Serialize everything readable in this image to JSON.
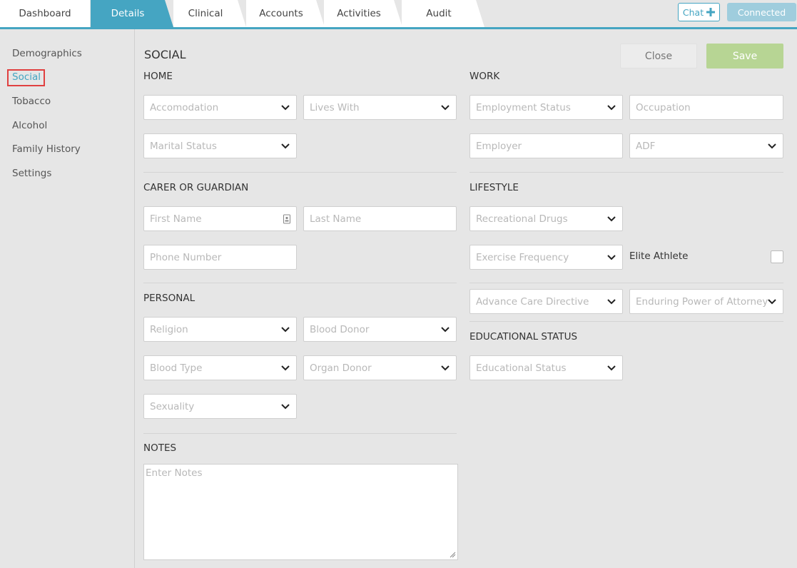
{
  "tabs": [
    "Dashboard",
    "Details",
    "Clinical",
    "Accounts",
    "Activities",
    "Audit"
  ],
  "header": {
    "chat_label": "Chat",
    "connected_label": "Connected"
  },
  "sidebar": {
    "items": [
      "Demographics",
      "Social",
      "Tobacco",
      "Alcohol",
      "Family History",
      "Settings"
    ],
    "active": "Social"
  },
  "page": {
    "title": "SOCIAL",
    "close_label": "Close",
    "save_label": "Save"
  },
  "sections": {
    "home": "HOME",
    "work": "WORK",
    "carer": "CARER OR GUARDIAN",
    "lifestyle": "LIFESTYLE",
    "personal": "PERSONAL",
    "educational": "EDUCATIONAL STATUS",
    "notes": "NOTES"
  },
  "fields": {
    "accomodation": "Accomodation",
    "lives_with": "Lives With",
    "marital_status": "Marital Status",
    "employment_status": "Employment Status",
    "occupation": "Occupation",
    "employer": "Employer",
    "adf": "ADF",
    "first_name": "First Name",
    "last_name": "Last Name",
    "phone_number": "Phone Number",
    "recreational_drugs": "Recreational Drugs",
    "exercise_frequency": "Exercise Frequency",
    "elite_athlete": "Elite Athlete",
    "advance_care_directive": "Advance Care Directive",
    "enduring_power": "Enduring Power of Attorney",
    "religion": "Religion",
    "blood_donor": "Blood Donor",
    "blood_type": "Blood Type",
    "organ_donor": "Organ Donor",
    "sexuality": "Sexuality",
    "educational_status": "Educational Status",
    "notes_placeholder": "Enter Notes"
  },
  "colors": {
    "accent": "#45a5c2",
    "save": "#b7d594",
    "highlight": "#e04040"
  }
}
